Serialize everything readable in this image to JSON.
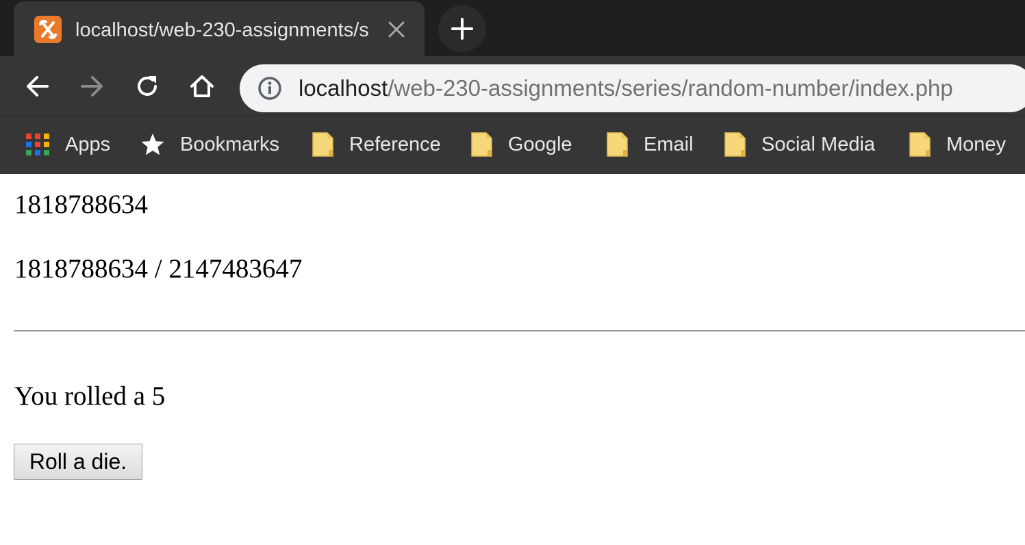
{
  "tab": {
    "title": "localhost/web-230-assignments/s",
    "favicon": "xampp-icon",
    "close": "close-icon"
  },
  "toolbar": {
    "back": "arrow-left-icon",
    "forward": "arrow-right-icon",
    "reload": "reload-icon",
    "home": "home-icon",
    "new_tab": "plus-icon"
  },
  "address_bar": {
    "host": "localhost",
    "path": "/web-230-assignments/series/random-number/index.php",
    "info_icon": "info-icon"
  },
  "bookmarks": [
    {
      "label": "Apps",
      "icon": "apps-grid-icon"
    },
    {
      "label": "Bookmarks",
      "icon": "star-icon"
    },
    {
      "label": "Reference",
      "icon": "folder-icon"
    },
    {
      "label": "Google",
      "icon": "folder-icon"
    },
    {
      "label": "Email",
      "icon": "folder-icon"
    },
    {
      "label": "Social Media",
      "icon": "folder-icon"
    },
    {
      "label": "Money",
      "icon": "folder-icon"
    }
  ],
  "page": {
    "random_value": "1818788634",
    "ratio_text": "1818788634 / 2147483647",
    "roll_result": "You rolled a 5",
    "roll_button": "Roll a die."
  },
  "colors": {
    "chrome_dark": "#1f1f1f",
    "chrome_toolbar": "#363636",
    "omnibox_bg": "#f1f3f4",
    "favicon_orange": "#ea7a2b",
    "folder_yellow": "#f6d77a"
  }
}
